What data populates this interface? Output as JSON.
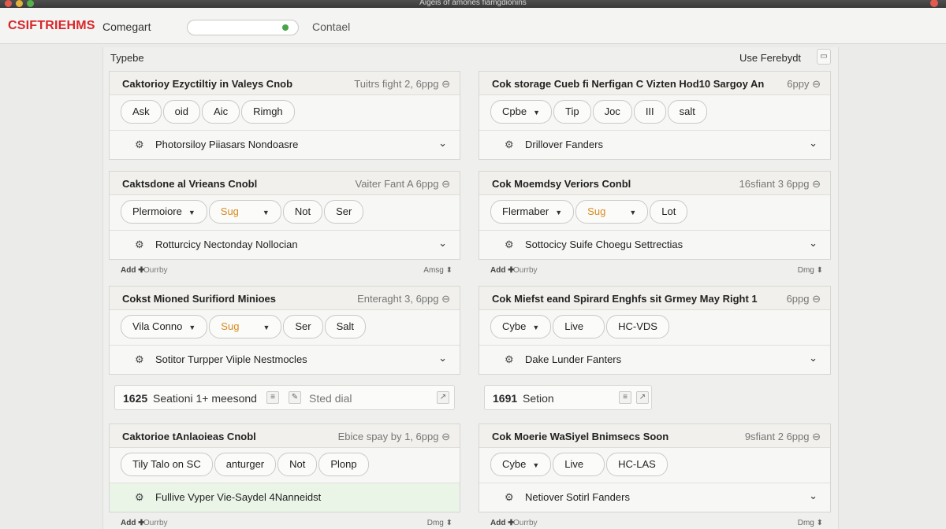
{
  "titlebar": {
    "title": "Aigeis of amones fiamgdionins"
  },
  "appbar": {
    "brand": "CSIFTRIEHMS",
    "nav_item": "Comegart",
    "contact": "Contael"
  },
  "header": {
    "left_label": "Typebe",
    "right_label": "Use Ferebydt"
  },
  "cards": [
    {
      "title": "Caktorioy Ezyctiltiy in Valeys Cnob",
      "meta": "Tuitrs fight 2, 6ppg ⊖",
      "chips": [
        {
          "label": "Ask"
        },
        {
          "label": "oid"
        },
        {
          "label": "Aic"
        },
        {
          "label": "Rimgh"
        }
      ],
      "footer": "Photorsiloy Piiasars Nondoasre"
    },
    {
      "title": "Cok storage Cueb fi Nerfigan C Vizten Hod10 Sargoy An 1",
      "meta": "6ppy ⊖",
      "chips": [
        {
          "label": "Cpbe",
          "caret": true
        },
        {
          "label": "Tip"
        },
        {
          "label": "Joc"
        },
        {
          "label": "III"
        },
        {
          "label": "salt"
        }
      ],
      "footer": "Drillover Fanders"
    },
    {
      "title": "Caktsdone al Vrieans Cnobl",
      "meta": "Vaiter Fant  A 6ppg ⊖",
      "chips": [
        {
          "label": "Plermoiore",
          "caret": true
        },
        {
          "label": "Sug",
          "caret": true,
          "orange": true
        },
        {
          "label": "Not"
        },
        {
          "label": "Ser"
        }
      ],
      "footer": "Rotturcicy Nectonday Nollocian"
    },
    {
      "title": "Cok Moemdsy Veriors Conbl",
      "meta": "16sfiant 3 6ppg ⊖",
      "chips": [
        {
          "label": "Flermaber",
          "caret": true
        },
        {
          "label": "Sug",
          "caret": true,
          "orange": true
        },
        {
          "label": "Lot"
        }
      ],
      "footer": "Sottocicy Suife Choegu Settrectias"
    },
    {
      "title": "Cokst Mioned Surifiord Minioes",
      "meta": "Enteraght 3, 6ppg ⊖",
      "chips": [
        {
          "label": "Vila Conno",
          "caret": true
        },
        {
          "label": "Sug",
          "caret": true,
          "orange": true
        },
        {
          "label": "Ser"
        },
        {
          "label": "Salt"
        }
      ],
      "footer": "Sotitor Turpper Viiple Nestmocles"
    },
    {
      "title": "Cok Miefst eand Spirard Enghfs sit Grmey May Right 1",
      "meta": "6ppg ⊖",
      "chips": [
        {
          "label": "Cybe",
          "caret": true
        },
        {
          "label": "Live"
        },
        {
          "label": "HC-VDS"
        }
      ],
      "footer": "Dake Lunder Fanters"
    },
    {
      "title": "Caktorioe tAnlaoieas Cnobl",
      "meta": "Ebice spay by 1, 6ppg ⊖",
      "chips": [
        {
          "label": "Tily Talo on SC"
        },
        {
          "label": "anturger"
        },
        {
          "label": "Not"
        },
        {
          "label": "Plonp"
        }
      ],
      "footer": "Fullive Vyper Vie-Saydel 4Nanneidst"
    },
    {
      "title": "Cok Moerie WaSiyel Bnimsecs Soon",
      "meta": "9sfiant 2 6ppg ⊖",
      "chips": [
        {
          "label": "Cybe",
          "caret": true
        },
        {
          "label": "Live"
        },
        {
          "label": "HC-LAS"
        }
      ],
      "footer": "Netiover Sotirl Fanders"
    }
  ],
  "subbar": {
    "add": "Add ✚",
    "category": "Ourrby",
    "left_action": "Amsg ⬍",
    "right_action": "Dmg ⬍"
  },
  "sections": [
    {
      "number": "1625",
      "text": "Seationi 1+ meesond",
      "sub": "Sted dial"
    },
    {
      "number": "1691",
      "text": "Setion"
    }
  ]
}
